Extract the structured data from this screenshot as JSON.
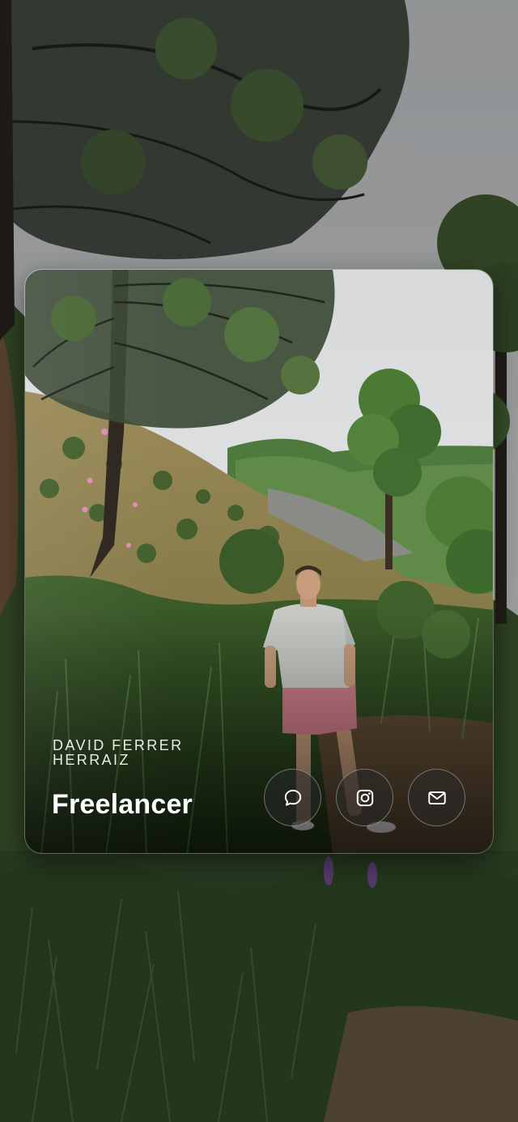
{
  "profile": {
    "name": "DAVID FERRER HERRAIZ",
    "role": "Freelancer"
  },
  "actions": [
    {
      "id": "chat",
      "icon": "chat-bubble-icon"
    },
    {
      "id": "instagram",
      "icon": "instagram-icon"
    },
    {
      "id": "email",
      "icon": "mail-icon"
    }
  ],
  "colors": {
    "text_primary": "#ffffff",
    "text_secondary": "#e9ece6",
    "button_bg": "rgba(40,40,40,0.55)",
    "sky": "#dadcdd",
    "foliage": "#3f5a2c"
  }
}
